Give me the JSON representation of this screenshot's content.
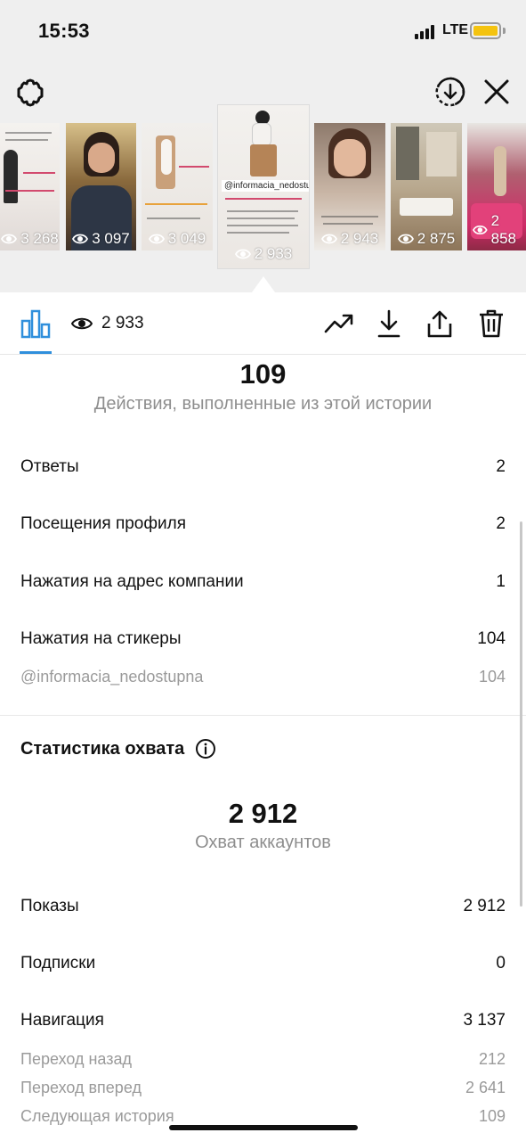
{
  "status_bar": {
    "time": "15:53",
    "network": "LTE",
    "battery_color": "#f4c30f"
  },
  "header": {
    "settings_icon": "gear-icon",
    "download_icon": "download-circle-icon",
    "close_icon": "close-icon"
  },
  "thumbnails": [
    {
      "views": "3 268"
    },
    {
      "views": "3 097"
    },
    {
      "views": "3 049"
    },
    {
      "views": "2 933",
      "selected": true,
      "tag": "@informacia_nedostupna"
    },
    {
      "views": "2 943"
    },
    {
      "views": "2 875"
    },
    {
      "views": "2 858"
    }
  ],
  "toolbar": {
    "insights_icon": "bar-chart-icon",
    "views": "2 933",
    "accent_color": "#2f8fdc",
    "actions": [
      "trend-icon",
      "download-icon",
      "share-icon",
      "trash-icon"
    ]
  },
  "interactions": {
    "total": "109",
    "caption": "Действия, выполненные из этой истории",
    "rows": [
      {
        "label": "Ответы",
        "value": "2"
      },
      {
        "label": "Посещения профиля",
        "value": "2"
      },
      {
        "label": "Нажатия на адрес компании",
        "value": "1"
      },
      {
        "label": "Нажатия на стикеры",
        "value": "104"
      }
    ],
    "sticker_sub": {
      "label": "@informacia_nedostupna",
      "value": "104"
    }
  },
  "reach": {
    "title": "Статистика охвата",
    "total": "2 912",
    "caption": "Охват аккаунтов",
    "rows": [
      {
        "label": "Показы",
        "value": "2 912"
      },
      {
        "label": "Подписки",
        "value": "0"
      },
      {
        "label": "Навигация",
        "value": "3 137"
      }
    ],
    "navigation_sub": [
      {
        "label": "Переход назад",
        "value": "212"
      },
      {
        "label": "Переход вперед",
        "value": "2 641"
      },
      {
        "label": "Следующая история",
        "value": "109"
      }
    ]
  }
}
